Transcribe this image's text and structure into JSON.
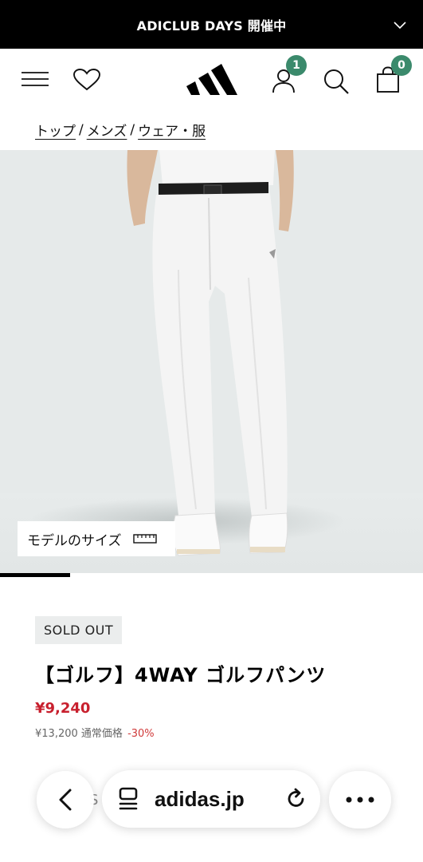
{
  "promo": {
    "text": "ADICLUB DAYS 開催中",
    "chevron_icon": "chevron-down-icon"
  },
  "header": {
    "menu_icon": "hamburger-menu-icon",
    "wishlist_icon": "heart-icon",
    "logo_icon": "adidas-logo-icon",
    "account_icon": "user-icon",
    "account_badge": "1",
    "search_icon": "search-icon",
    "cart_icon": "shopping-bag-icon",
    "cart_badge": "0",
    "badge_color": "#3b8a6c"
  },
  "breadcrumb": {
    "items": [
      {
        "label": "トップ"
      },
      {
        "label": "メンズ"
      },
      {
        "label": "ウェア・服"
      }
    ],
    "separator": "/"
  },
  "gallery": {
    "model_size_label": "モデルのサイズ",
    "model_size_icon": "ruler-icon",
    "progress_fraction": 0.166
  },
  "product": {
    "status_badge": "SOLD OUT",
    "title": "【ゴルフ】4WAY ゴルフパンツ",
    "sale_price": "¥9,240",
    "original_price": "¥13,200",
    "original_price_label": "通常価格",
    "discount": "-30%",
    "sale_color": "#c8202e"
  },
  "partial_text": "S",
  "browser": {
    "back_icon": "back-arrow-icon",
    "tabs_icon": "page-menu-icon",
    "url": "adidas.jp",
    "reload_icon": "reload-icon",
    "more_icon": "more-dots-icon"
  }
}
